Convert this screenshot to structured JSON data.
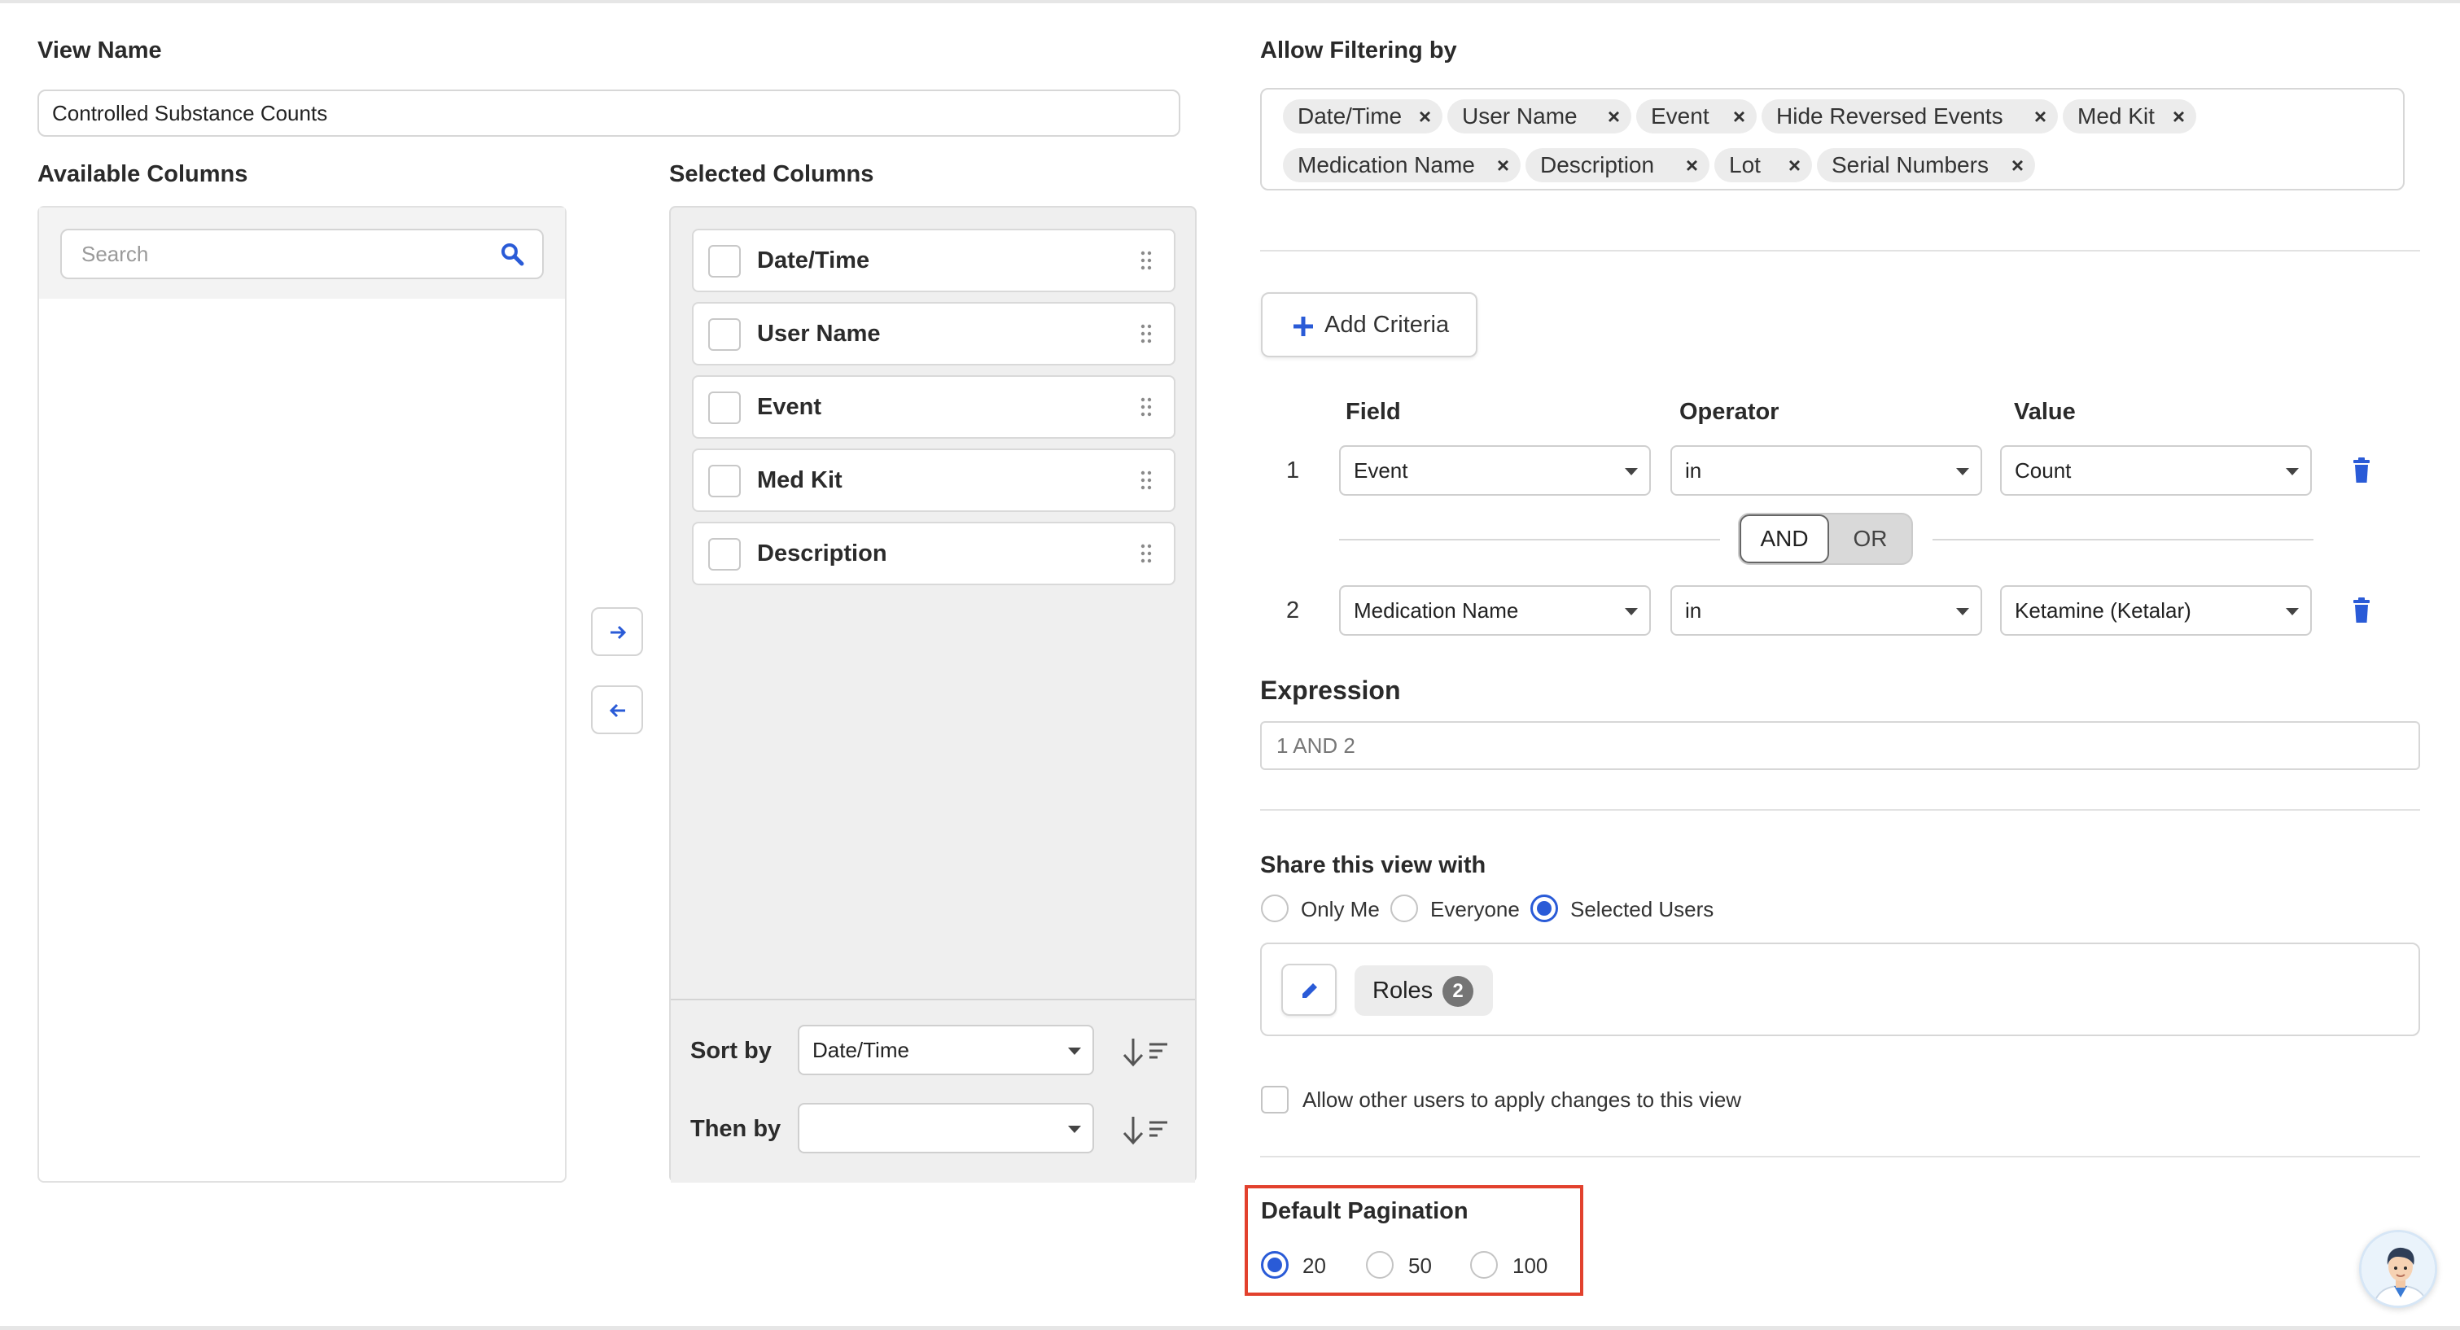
{
  "view_name": {
    "label": "View Name",
    "value": "Controlled Substance Counts"
  },
  "available_columns": {
    "label": "Available Columns",
    "search_placeholder": "Search"
  },
  "selected_columns": {
    "label": "Selected Columns",
    "items": [
      "Date/Time",
      "User Name",
      "Event",
      "Med Kit",
      "Description"
    ],
    "sort_by_label": "Sort by",
    "sort_by_value": "Date/Time",
    "then_by_label": "Then by",
    "then_by_value": ""
  },
  "filtering": {
    "label": "Allow Filtering by",
    "tags": [
      "Date/Time",
      "User Name",
      "Event",
      "Hide Reversed Events",
      "Med Kit",
      "Medication Name",
      "Description",
      "Lot",
      "Serial Numbers"
    ],
    "remove_glyph": "×"
  },
  "criteria": {
    "add_label": "Add Criteria",
    "headers": {
      "field": "Field",
      "operator": "Operator",
      "value": "Value"
    },
    "rows": [
      {
        "num": "1",
        "field": "Event",
        "operator": "in",
        "value": "Count"
      },
      {
        "num": "2",
        "field": "Medication Name",
        "operator": "in",
        "value": "Ketamine (Ketalar)"
      }
    ],
    "and_label": "AND",
    "or_label": "OR"
  },
  "expression": {
    "label": "Expression",
    "value": "1 AND 2"
  },
  "share": {
    "label": "Share this view with",
    "options": [
      "Only Me",
      "Everyone",
      "Selected Users"
    ],
    "selected": "Selected Users",
    "roles_label": "Roles",
    "roles_count": "2",
    "allow_changes_label": "Allow other users to apply changes to this view"
  },
  "pagination": {
    "label": "Default Pagination",
    "options": [
      "20",
      "50",
      "100"
    ],
    "selected": "20"
  },
  "colors": {
    "accent": "#2a5bd7",
    "highlight": "#e2412d"
  }
}
